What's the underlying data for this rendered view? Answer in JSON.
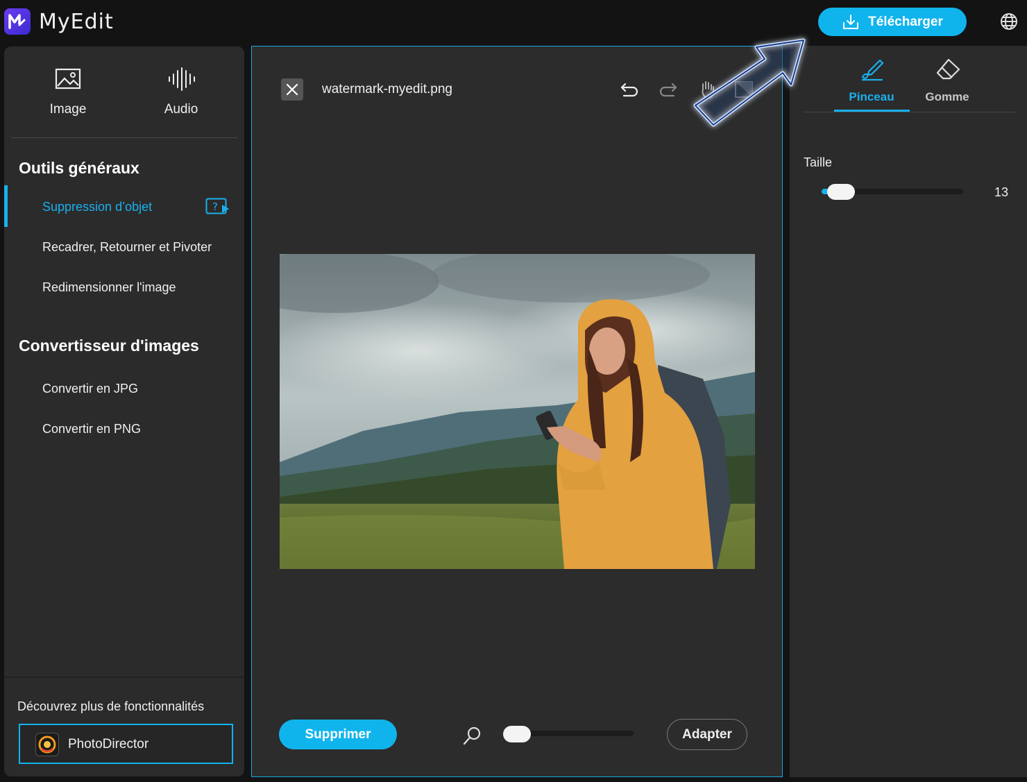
{
  "app": {
    "name": "MyEdit",
    "logo_icon": "myedit-logo-icon"
  },
  "header": {
    "download_label": "Télécharger",
    "download_icon": "download-icon",
    "language_icon": "globe-icon"
  },
  "sidebar": {
    "modes": [
      {
        "label": "Image",
        "icon": "image-icon"
      },
      {
        "label": "Audio",
        "icon": "audio-waveform-icon"
      }
    ],
    "sections": [
      {
        "title": "Outils généraux",
        "items": [
          {
            "label": "Suppression d’objet",
            "active": true
          },
          {
            "label": "Recadrer, Retourner et Pivoter"
          },
          {
            "label": "Redimensionner l'image"
          }
        ]
      },
      {
        "title": "Convertisseur d'images",
        "items": [
          {
            "label": "Convertir en JPG"
          },
          {
            "label": "Convertir en PNG"
          }
        ]
      }
    ],
    "footer": {
      "discover_label": "Découvrez plus de fonctionnalités",
      "photodirector_label": "PhotoDirector"
    }
  },
  "editor": {
    "filename": "watermark-myedit.png",
    "toolbar_icons": [
      "undo-icon",
      "redo-icon",
      "hand-pan-icon",
      "compare-icon"
    ],
    "delete_label": "Supprimer",
    "fit_label": "Adapter",
    "zoom_level": 0.0
  },
  "brush_panel": {
    "tabs": [
      {
        "label": "Pinceau",
        "icon": "brush-icon",
        "active": true
      },
      {
        "label": "Gomme",
        "icon": "eraser-icon"
      }
    ],
    "size_label": "Taille",
    "size_value": "13",
    "size_fraction": 0.06
  },
  "colors": {
    "accent": "#10b4ec",
    "panel": "#2b2b2b",
    "background": "#131313"
  }
}
